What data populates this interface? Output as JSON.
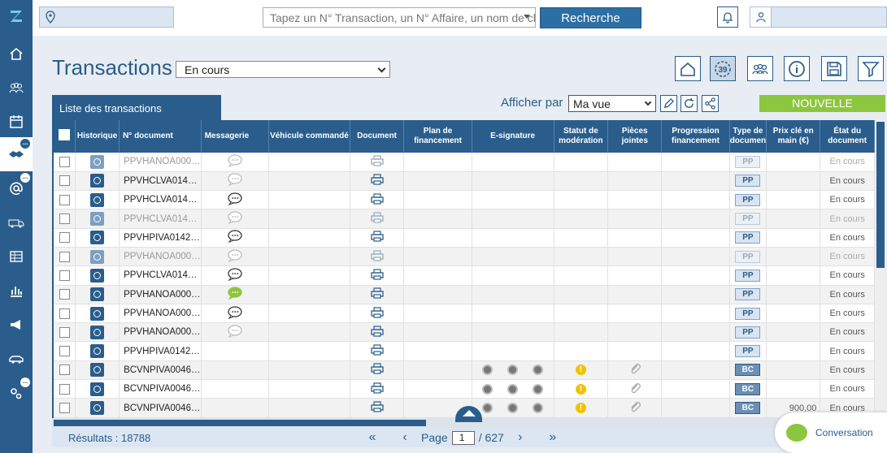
{
  "app": {
    "logo": "Z"
  },
  "sidebar": {
    "items": [
      {
        "name": "home",
        "badge": ""
      },
      {
        "name": "team",
        "badge": ""
      },
      {
        "name": "calendar",
        "badge": ""
      },
      {
        "name": "deals",
        "badge": "..."
      },
      {
        "name": "email",
        "badge": "..."
      },
      {
        "name": "vehicles",
        "badge": ""
      },
      {
        "name": "table",
        "badge": ""
      },
      {
        "name": "reports",
        "badge": ""
      },
      {
        "name": "marketing",
        "badge": ""
      },
      {
        "name": "car",
        "badge": ""
      },
      {
        "name": "settings",
        "badge": "..."
      }
    ]
  },
  "topbar": {
    "location_value": "",
    "search_placeholder": "Tapez un N° Transaction, un N° Affaire, un nom de clie…",
    "search_button": "Recherche",
    "user_name": ""
  },
  "page": {
    "title": "Transactions",
    "status_filter": "En cours",
    "tab_label": "Liste des transactions",
    "afficher_label": "Afficher par",
    "view_value": "Ma vue",
    "new_button": "NOUVELLE",
    "alert_count": "39"
  },
  "table": {
    "columns": [
      "",
      "Historique",
      "N° document",
      "Messagerie",
      "Véhicule commandé",
      "Document",
      "Plan de financement",
      "E-signature",
      "Statut de modération",
      "Pièces jointes",
      "Progression financement",
      "Type de documen",
      "Prix clé en main (€)",
      "État du document"
    ],
    "rows": [
      {
        "doc": "PPVHANOA000…",
        "type": "PP",
        "prix": "",
        "etat": "En cours",
        "light": true,
        "msg": "light",
        "esign": false
      },
      {
        "doc": "PPVHCLVA014…",
        "type": "PP",
        "prix": "",
        "etat": "En cours",
        "light": false,
        "msg": "light",
        "esign": false
      },
      {
        "doc": "PPVHCLVA014…",
        "type": "PP",
        "prix": "",
        "etat": "En cours",
        "light": false,
        "msg": "dark",
        "esign": false
      },
      {
        "doc": "PPVHCLVA014…",
        "type": "PP",
        "prix": "",
        "etat": "En cours",
        "light": true,
        "msg": "light",
        "esign": false
      },
      {
        "doc": "PPVHPIVA0142…",
        "type": "PP",
        "prix": "",
        "etat": "En cours",
        "light": false,
        "msg": "dark",
        "esign": false
      },
      {
        "doc": "PPVHANOA000…",
        "type": "PP",
        "prix": "",
        "etat": "En cours",
        "light": true,
        "msg": "light",
        "esign": false
      },
      {
        "doc": "PPVHCLVA014…",
        "type": "PP",
        "prix": "",
        "etat": "En cours",
        "light": false,
        "msg": "dark",
        "esign": false
      },
      {
        "doc": "PPVHANOA000…",
        "type": "PP",
        "prix": "",
        "etat": "En cours",
        "light": false,
        "msg": "green",
        "esign": false
      },
      {
        "doc": "PPVHANOA000…",
        "type": "PP",
        "prix": "",
        "etat": "En cours",
        "light": false,
        "msg": "dark",
        "esign": false
      },
      {
        "doc": "PPVHANOA000…",
        "type": "PP",
        "prix": "",
        "etat": "En cours",
        "light": false,
        "msg": "light",
        "esign": false
      },
      {
        "doc": "PPVHPIVA0142…",
        "type": "PP",
        "prix": "",
        "etat": "En cours",
        "light": false,
        "msg": "none",
        "esign": false
      },
      {
        "doc": "BCVNPIVA0046…",
        "type": "BC",
        "prix": "",
        "etat": "En cours",
        "light": false,
        "msg": "none",
        "esign": true
      },
      {
        "doc": "BCVNPIVA0046…",
        "type": "BC",
        "prix": "",
        "etat": "En cours",
        "light": false,
        "msg": "none",
        "esign": true
      },
      {
        "doc": "BCVNPIVA0046…",
        "type": "BC",
        "prix": "900,00",
        "etat": "En cours",
        "light": false,
        "msg": "none",
        "esign": true
      }
    ]
  },
  "footer": {
    "results": "Résultats : 18788",
    "page_label": "Page",
    "page_value": "1",
    "page_total": "/ 627",
    "first": "«",
    "prev": "‹",
    "next": "›",
    "last": "»"
  },
  "chat": {
    "label": "Conversation"
  },
  "colors": {
    "primary": "#2a5d8c",
    "accent": "#8cc63f",
    "warning": "#f2c200"
  }
}
